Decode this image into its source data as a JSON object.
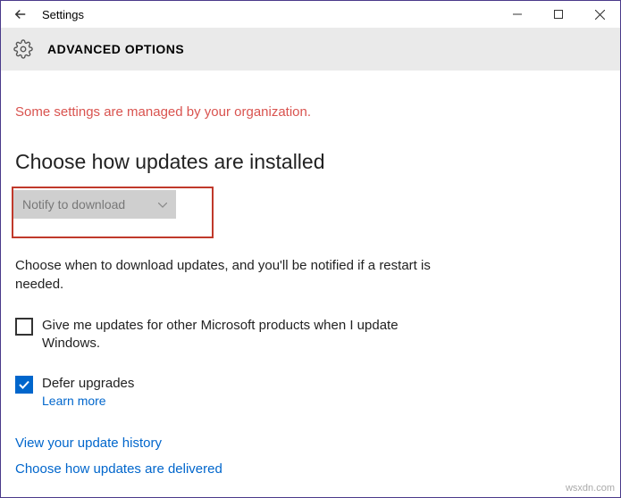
{
  "titlebar": {
    "title": "Settings"
  },
  "header": {
    "title": "ADVANCED OPTIONS"
  },
  "notice": "Some settings are managed by your organization.",
  "section": {
    "heading": "Choose how updates are installed",
    "dropdown_value": "Notify to download",
    "description": "Choose when to download updates, and you'll be notified if a restart is needed."
  },
  "options": {
    "other_products": {
      "label": "Give me updates for other Microsoft products when I update Windows.",
      "checked": false
    },
    "defer": {
      "label": "Defer upgrades",
      "learn_more": "Learn more",
      "checked": true
    }
  },
  "links": {
    "history": "View your update history",
    "delivery": "Choose how updates are delivered"
  },
  "watermark": "wsxdn.com"
}
